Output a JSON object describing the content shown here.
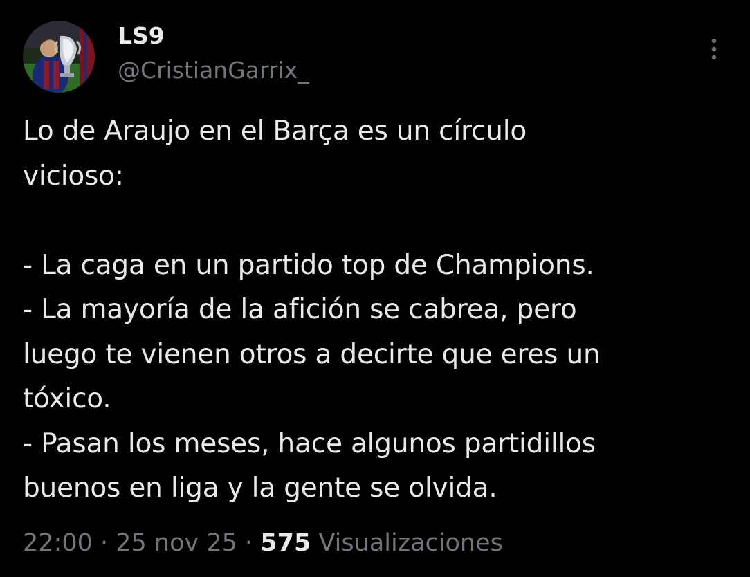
{
  "colors": {
    "background": "#000000",
    "primary_text": "#e7e9ea",
    "secondary_text": "#71767b"
  },
  "author": {
    "display_name": "LS9",
    "handle": "@CristianGarrix_",
    "avatar_icon": "avatar-photo-with-trophy"
  },
  "more_menu_icon": "more-vertical-icon",
  "tweet": {
    "lines": [
      "Lo de Araujo en el Barça es un círculo",
      "vicioso:",
      "",
      "- La caga en un partido top de Champions.",
      "- La mayoría de la afición se cabrea, pero",
      "luego te vienen otros a decirte que eres un",
      "tóxico.",
      "- Pasan los meses, hace algunos partidillos",
      "buenos en liga y la gente se olvida."
    ]
  },
  "meta": {
    "time": "22:00",
    "separator": " · ",
    "date": "25 nov 25",
    "views_count": "575",
    "views_label": "Visualizaciones"
  }
}
